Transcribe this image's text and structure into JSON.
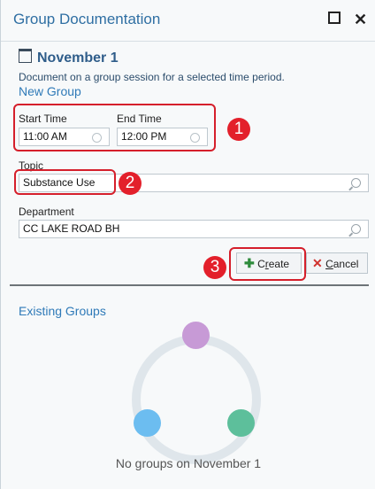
{
  "window": {
    "title": "Group Documentation"
  },
  "header": {
    "date": "November 1",
    "description": "Document on a group session for a selected time period.",
    "new_group": "New Group"
  },
  "form": {
    "start_time_label": "Start Time",
    "start_time": "11:00 AM",
    "end_time_label": "End Time",
    "end_time": "12:00 PM",
    "topic_label": "Topic",
    "topic": "Substance Use",
    "department_label": "Department",
    "department": "CC LAKE ROAD BH"
  },
  "buttons": {
    "create_pre": "C",
    "create_u": "r",
    "create_post": "eate",
    "cancel_u": "C",
    "cancel_post": "ancel"
  },
  "annotations": [
    "1",
    "2",
    "3"
  ],
  "existing": {
    "heading": "Existing Groups",
    "empty_text": "No groups on November 1"
  },
  "colors": {
    "title": "#2f6fa3",
    "annotation": "#d51f2b",
    "dot_top": "#c79ad6",
    "dot_left": "#6cbdf0",
    "dot_right": "#5dbf9b",
    "create_icon": "#2e8b3c",
    "cancel_icon": "#d0312d"
  },
  "icons": [
    "calendar-icon",
    "clock-icon",
    "search-icon",
    "plus-icon",
    "close-x-icon",
    "maximize-icon"
  ]
}
